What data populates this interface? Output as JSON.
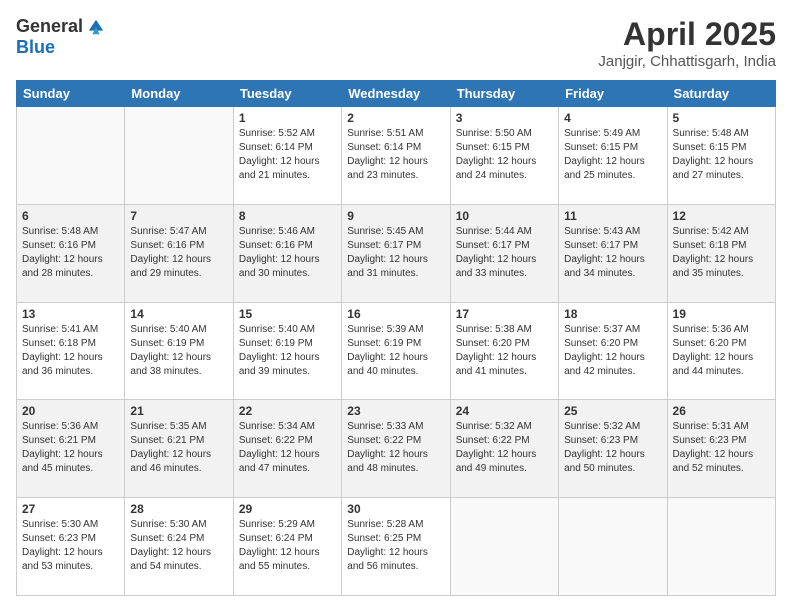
{
  "logo": {
    "general": "General",
    "blue": "Blue"
  },
  "header": {
    "month": "April 2025",
    "location": "Janjgir, Chhattisgarh, India"
  },
  "weekdays": [
    "Sunday",
    "Monday",
    "Tuesday",
    "Wednesday",
    "Thursday",
    "Friday",
    "Saturday"
  ],
  "weeks": [
    [
      {
        "day": "",
        "info": ""
      },
      {
        "day": "",
        "info": ""
      },
      {
        "day": "1",
        "info": "Sunrise: 5:52 AM\nSunset: 6:14 PM\nDaylight: 12 hours and 21 minutes."
      },
      {
        "day": "2",
        "info": "Sunrise: 5:51 AM\nSunset: 6:14 PM\nDaylight: 12 hours and 23 minutes."
      },
      {
        "day": "3",
        "info": "Sunrise: 5:50 AM\nSunset: 6:15 PM\nDaylight: 12 hours and 24 minutes."
      },
      {
        "day": "4",
        "info": "Sunrise: 5:49 AM\nSunset: 6:15 PM\nDaylight: 12 hours and 25 minutes."
      },
      {
        "day": "5",
        "info": "Sunrise: 5:48 AM\nSunset: 6:15 PM\nDaylight: 12 hours and 27 minutes."
      }
    ],
    [
      {
        "day": "6",
        "info": "Sunrise: 5:48 AM\nSunset: 6:16 PM\nDaylight: 12 hours and 28 minutes."
      },
      {
        "day": "7",
        "info": "Sunrise: 5:47 AM\nSunset: 6:16 PM\nDaylight: 12 hours and 29 minutes."
      },
      {
        "day": "8",
        "info": "Sunrise: 5:46 AM\nSunset: 6:16 PM\nDaylight: 12 hours and 30 minutes."
      },
      {
        "day": "9",
        "info": "Sunrise: 5:45 AM\nSunset: 6:17 PM\nDaylight: 12 hours and 31 minutes."
      },
      {
        "day": "10",
        "info": "Sunrise: 5:44 AM\nSunset: 6:17 PM\nDaylight: 12 hours and 33 minutes."
      },
      {
        "day": "11",
        "info": "Sunrise: 5:43 AM\nSunset: 6:17 PM\nDaylight: 12 hours and 34 minutes."
      },
      {
        "day": "12",
        "info": "Sunrise: 5:42 AM\nSunset: 6:18 PM\nDaylight: 12 hours and 35 minutes."
      }
    ],
    [
      {
        "day": "13",
        "info": "Sunrise: 5:41 AM\nSunset: 6:18 PM\nDaylight: 12 hours and 36 minutes."
      },
      {
        "day": "14",
        "info": "Sunrise: 5:40 AM\nSunset: 6:19 PM\nDaylight: 12 hours and 38 minutes."
      },
      {
        "day": "15",
        "info": "Sunrise: 5:40 AM\nSunset: 6:19 PM\nDaylight: 12 hours and 39 minutes."
      },
      {
        "day": "16",
        "info": "Sunrise: 5:39 AM\nSunset: 6:19 PM\nDaylight: 12 hours and 40 minutes."
      },
      {
        "day": "17",
        "info": "Sunrise: 5:38 AM\nSunset: 6:20 PM\nDaylight: 12 hours and 41 minutes."
      },
      {
        "day": "18",
        "info": "Sunrise: 5:37 AM\nSunset: 6:20 PM\nDaylight: 12 hours and 42 minutes."
      },
      {
        "day": "19",
        "info": "Sunrise: 5:36 AM\nSunset: 6:20 PM\nDaylight: 12 hours and 44 minutes."
      }
    ],
    [
      {
        "day": "20",
        "info": "Sunrise: 5:36 AM\nSunset: 6:21 PM\nDaylight: 12 hours and 45 minutes."
      },
      {
        "day": "21",
        "info": "Sunrise: 5:35 AM\nSunset: 6:21 PM\nDaylight: 12 hours and 46 minutes."
      },
      {
        "day": "22",
        "info": "Sunrise: 5:34 AM\nSunset: 6:22 PM\nDaylight: 12 hours and 47 minutes."
      },
      {
        "day": "23",
        "info": "Sunrise: 5:33 AM\nSunset: 6:22 PM\nDaylight: 12 hours and 48 minutes."
      },
      {
        "day": "24",
        "info": "Sunrise: 5:32 AM\nSunset: 6:22 PM\nDaylight: 12 hours and 49 minutes."
      },
      {
        "day": "25",
        "info": "Sunrise: 5:32 AM\nSunset: 6:23 PM\nDaylight: 12 hours and 50 minutes."
      },
      {
        "day": "26",
        "info": "Sunrise: 5:31 AM\nSunset: 6:23 PM\nDaylight: 12 hours and 52 minutes."
      }
    ],
    [
      {
        "day": "27",
        "info": "Sunrise: 5:30 AM\nSunset: 6:23 PM\nDaylight: 12 hours and 53 minutes."
      },
      {
        "day": "28",
        "info": "Sunrise: 5:30 AM\nSunset: 6:24 PM\nDaylight: 12 hours and 54 minutes."
      },
      {
        "day": "29",
        "info": "Sunrise: 5:29 AM\nSunset: 6:24 PM\nDaylight: 12 hours and 55 minutes."
      },
      {
        "day": "30",
        "info": "Sunrise: 5:28 AM\nSunset: 6:25 PM\nDaylight: 12 hours and 56 minutes."
      },
      {
        "day": "",
        "info": ""
      },
      {
        "day": "",
        "info": ""
      },
      {
        "day": "",
        "info": ""
      }
    ]
  ]
}
